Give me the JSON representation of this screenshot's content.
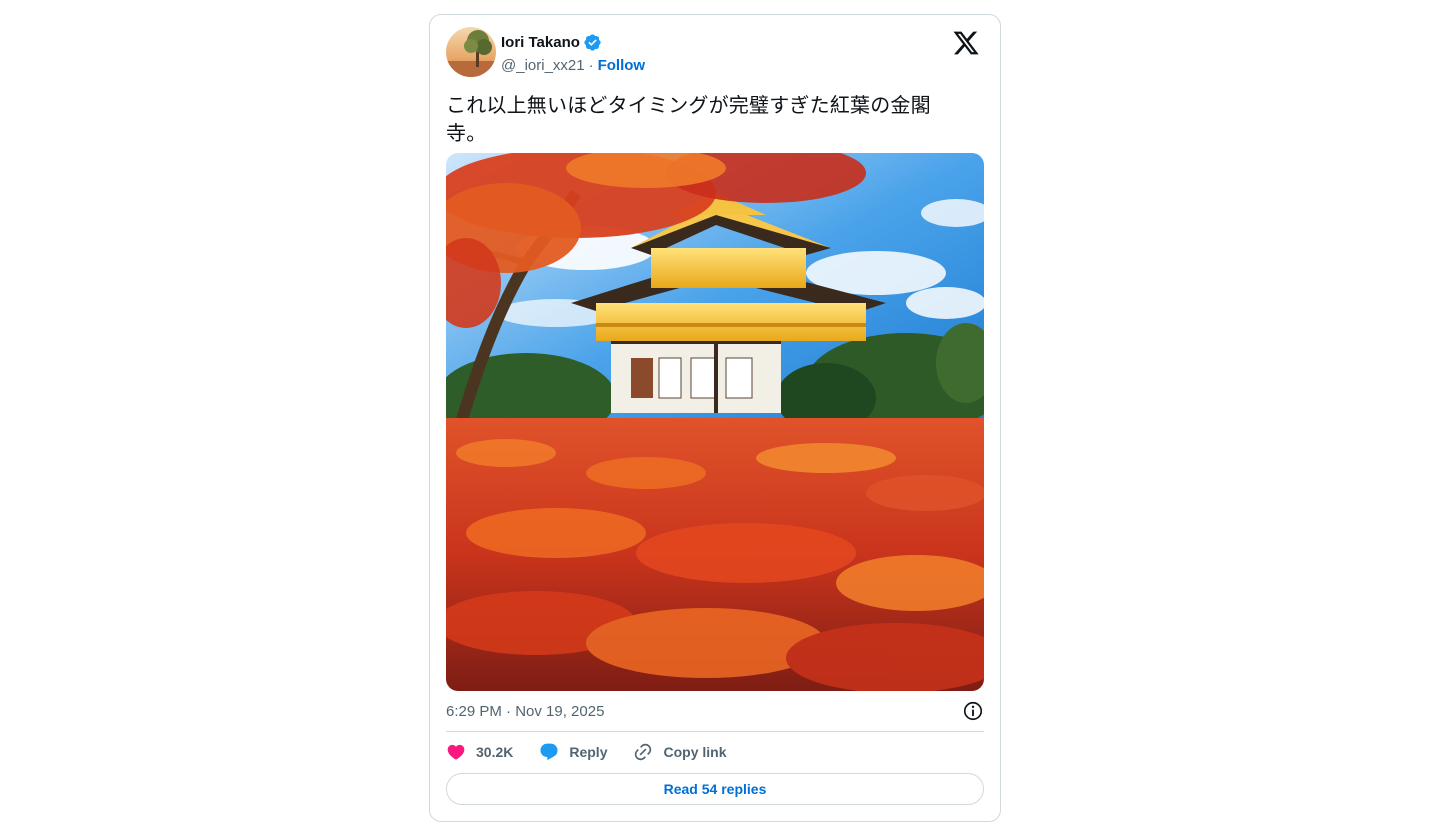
{
  "author": {
    "display_name": "Iori Takano",
    "handle": "@_iori_xx21",
    "separator": "·",
    "follow_label": "Follow",
    "verified": true,
    "avatar_icon": "avatar-landscape-icon"
  },
  "brand": {
    "logo_icon": "x-logo-icon"
  },
  "tweet": {
    "text": "これ以上無いほどタイミングが完璧すぎた紅葉の金閣寺。",
    "media_icon": "photo-kinkakuji-autumn"
  },
  "meta": {
    "timestamp": "6:29 PM · Nov 19, 2025"
  },
  "actions": {
    "like_count": "30.2K",
    "reply_label": "Reply",
    "copy_link_label": "Copy link"
  },
  "footer": {
    "read_replies_label": "Read 54 replies"
  },
  "colors": {
    "accent": "#006fd6",
    "like": "#f91880",
    "reply_icon": "#1d9bf0",
    "verified": "#1d9bf0",
    "muted_text": "#536471",
    "border": "#cfd9de"
  }
}
